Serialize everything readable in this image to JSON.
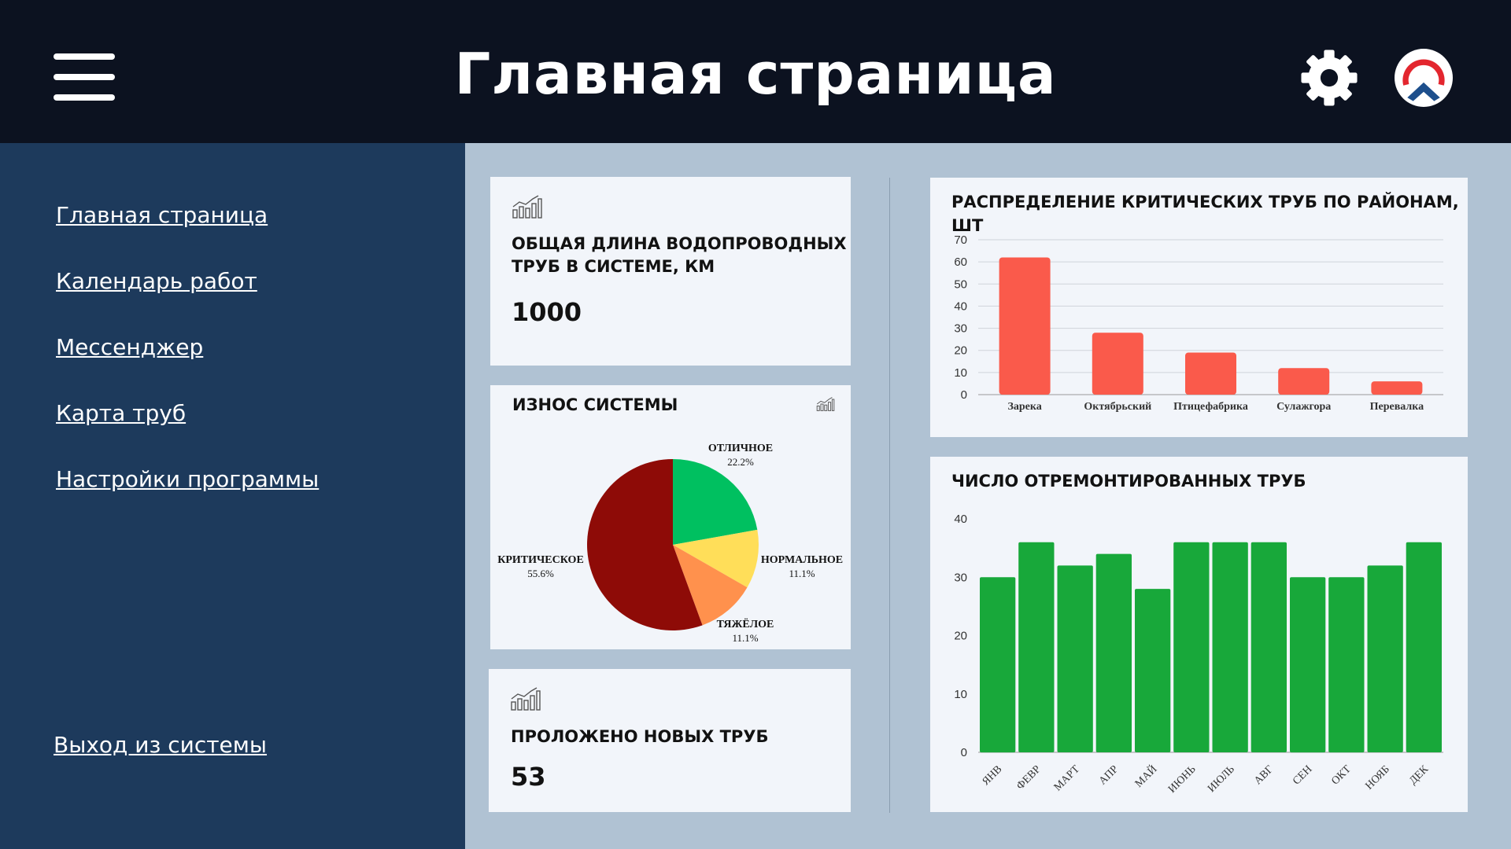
{
  "header": {
    "title": "Главная страница",
    "menu_icon": "hamburger-menu-icon",
    "settings_icon": "gear-icon",
    "logo_icon": "app-logo-icon"
  },
  "sidebar": {
    "items": [
      {
        "label": "Главная страница"
      },
      {
        "label": "Календарь работ"
      },
      {
        "label": "Мессенджер"
      },
      {
        "label": "Карта труб"
      },
      {
        "label": "Настройки программы"
      }
    ],
    "logout_label": "Выход из системы"
  },
  "cards": {
    "total_length": {
      "title_line1": "ОБЩАЯ ДЛИНА ВОДОПРОВОДНЫХ",
      "title_line2": "ТРУБ В СИСТЕМЕ, КМ",
      "value": "1000",
      "icon": "bar-growth-chart-icon"
    },
    "wear": {
      "title": "ИЗНОС СИСТЕМЫ",
      "icon": "bar-growth-chart-icon"
    },
    "new_pipes": {
      "title": "ПРОЛОЖЕНО НОВЫХ ТРУБ",
      "value": "53",
      "icon": "bar-growth-chart-icon"
    },
    "critical_chart": {
      "title": "РАСПРЕДЕЛЕНИЕ КРИТИЧЕСКИХ ТРУБ ПО РАЙОНАМ, ШТ"
    },
    "repaired_chart": {
      "title": "ЧИСЛО ОТРЕМОНТИРОВАННЫХ ТРУБ"
    }
  },
  "colors": {
    "header_bg": "#0c1220",
    "sidebar_bg": "#1d3a5c",
    "content_bg": "#b0c2d3",
    "card_bg": "#f2f5fa",
    "bar_red": "#fa5a4b",
    "bar_green": "#18a83a",
    "pie_excellent": "#00c060",
    "pie_normal": "#ffde59",
    "pie_heavy": "#ff914d",
    "pie_critical": "#8e0b07"
  },
  "chart_data": [
    {
      "type": "pie",
      "title": "ИЗНОС СИСТЕМЫ",
      "slices": [
        {
          "label": "ОТЛИЧНОЕ",
          "value": 22.2,
          "value_label": "22.2%",
          "color": "#00c060"
        },
        {
          "label": "НОРМАЛЬНОЕ",
          "value": 11.1,
          "value_label": "11.1%",
          "color": "#ffde59"
        },
        {
          "label": "ТЯЖЁЛОЕ",
          "value": 11.1,
          "value_label": "11.1%",
          "color": "#ff914d"
        },
        {
          "label": "КРИТИЧЕСКОЕ",
          "value": 55.6,
          "value_label": "55.6%",
          "color": "#8e0b07"
        }
      ]
    },
    {
      "type": "bar",
      "title": "РАСПРЕДЕЛЕНИЕ КРИТИЧЕСКИХ ТРУБ ПО РАЙОНАМ, ШТ",
      "categories": [
        "Зарека",
        "Октябрьский",
        "Птицефабрика",
        "Сулажгора",
        "Перевалка"
      ],
      "values": [
        62,
        28,
        19,
        12,
        6
      ],
      "ylim": [
        0,
        70
      ],
      "yticks": [
        0,
        10,
        20,
        30,
        40,
        50,
        60,
        70
      ],
      "grid": true,
      "color": "#fa5a4b"
    },
    {
      "type": "bar",
      "title": "ЧИСЛО ОТРЕМОНТИРОВАННЫХ ТРУБ",
      "categories": [
        "ЯНВ",
        "ФЕВР",
        "МАРТ",
        "АПР",
        "МАЙ",
        "ИЮНЬ",
        "ИЮЛЬ",
        "АВГ",
        "СЕН",
        "ОКТ",
        "НОЯБ",
        "ДЕК"
      ],
      "values": [
        30,
        36,
        32,
        34,
        28,
        36,
        36,
        36,
        30,
        30,
        32,
        36
      ],
      "ylim": [
        0,
        40
      ],
      "yticks": [
        0,
        10,
        20,
        30,
        40
      ],
      "grid": false,
      "color": "#18a83a"
    }
  ]
}
